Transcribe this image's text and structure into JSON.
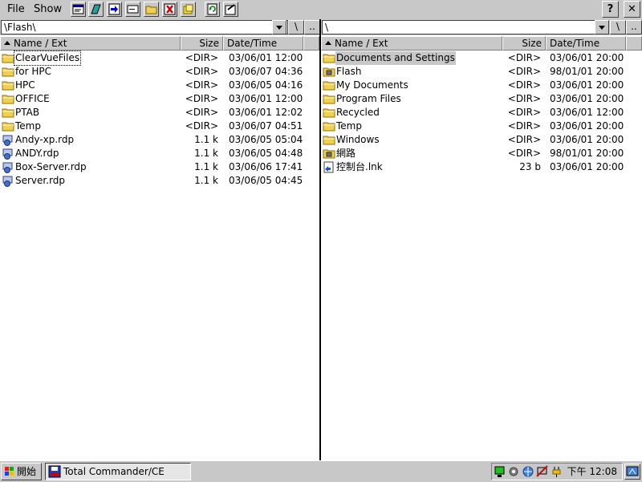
{
  "menu": {
    "file": "File",
    "show": "Show"
  },
  "toolbar": {
    "buttons": [
      "properties-icon",
      "copy-icon",
      "move-icon",
      "rename-icon",
      "new-folder-icon",
      "delete-icon",
      "pack-icon",
      "refresh-icon",
      "settings-icon"
    ]
  },
  "title_buttons": {
    "help": "?",
    "close": "✕"
  },
  "left_panel": {
    "path": "\\Flash\\",
    "root_btn": "\\",
    "up_btn": "..",
    "headers": {
      "name": "Name / Ext",
      "size": "Size",
      "date": "Date/Time"
    },
    "files": [
      {
        "name": "ClearVueFiles",
        "size": "<DIR>",
        "date": "03/06/01 12:00",
        "icon": "folder-icon"
      },
      {
        "name": "for HPC",
        "size": "<DIR>",
        "date": "03/06/07 04:36",
        "icon": "folder-icon"
      },
      {
        "name": "HPC",
        "size": "<DIR>",
        "date": "03/06/05 04:16",
        "icon": "folder-icon"
      },
      {
        "name": "OFFICE",
        "size": "<DIR>",
        "date": "03/06/01 12:00",
        "icon": "folder-icon"
      },
      {
        "name": "PTAB",
        "size": "<DIR>",
        "date": "03/06/01 12:02",
        "icon": "folder-icon"
      },
      {
        "name": "Temp",
        "size": "<DIR>",
        "date": "03/06/07 04:51",
        "icon": "folder-icon"
      },
      {
        "name": "Andy-xp.rdp",
        "size": "1.1 k",
        "date": "03/06/05 05:04",
        "icon": "remote-desktop-icon"
      },
      {
        "name": "ANDY.rdp",
        "size": "1.1 k",
        "date": "03/06/05 04:48",
        "icon": "remote-desktop-icon"
      },
      {
        "name": "Box-Server.rdp",
        "size": "1.1 k",
        "date": "03/06/06 17:41",
        "icon": "remote-desktop-icon"
      },
      {
        "name": "Server.rdp",
        "size": "1.1 k",
        "date": "03/06/05 04:45",
        "icon": "remote-desktop-icon"
      }
    ]
  },
  "right_panel": {
    "path": "\\",
    "root_btn": "\\",
    "up_btn": "..",
    "headers": {
      "name": "Name / Ext",
      "size": "Size",
      "date": "Date/Time"
    },
    "files": [
      {
        "name": "Documents and Settings",
        "size": "<DIR>",
        "date": "03/06/01 20:00",
        "icon": "folder-icon"
      },
      {
        "name": "Flash",
        "size": "<DIR>",
        "date": "98/01/01 20:00",
        "icon": "storage-folder-icon"
      },
      {
        "name": "My Documents",
        "size": "<DIR>",
        "date": "03/06/01 20:00",
        "icon": "folder-icon"
      },
      {
        "name": "Program Files",
        "size": "<DIR>",
        "date": "03/06/01 20:00",
        "icon": "folder-icon"
      },
      {
        "name": "Recycled",
        "size": "<DIR>",
        "date": "03/06/01 12:00",
        "icon": "folder-icon"
      },
      {
        "name": "Temp",
        "size": "<DIR>",
        "date": "03/06/01 20:00",
        "icon": "folder-icon"
      },
      {
        "name": "Windows",
        "size": "<DIR>",
        "date": "03/06/01 20:00",
        "icon": "folder-icon"
      },
      {
        "name": "網路",
        "size": "<DIR>",
        "date": "98/01/01 20:00",
        "icon": "storage-folder-icon"
      },
      {
        "name": "控制台.lnk",
        "size": "23 b",
        "date": "03/06/01 20:00",
        "icon": "shortcut-icon"
      }
    ]
  },
  "taskbar": {
    "start_label": "開始",
    "task_label": "Total Commander/CE",
    "clock": "下午 12:08"
  },
  "colors": {
    "chrome": "#c8c8c8",
    "selection": "#c8c8c8",
    "folder": "#f0d050"
  }
}
